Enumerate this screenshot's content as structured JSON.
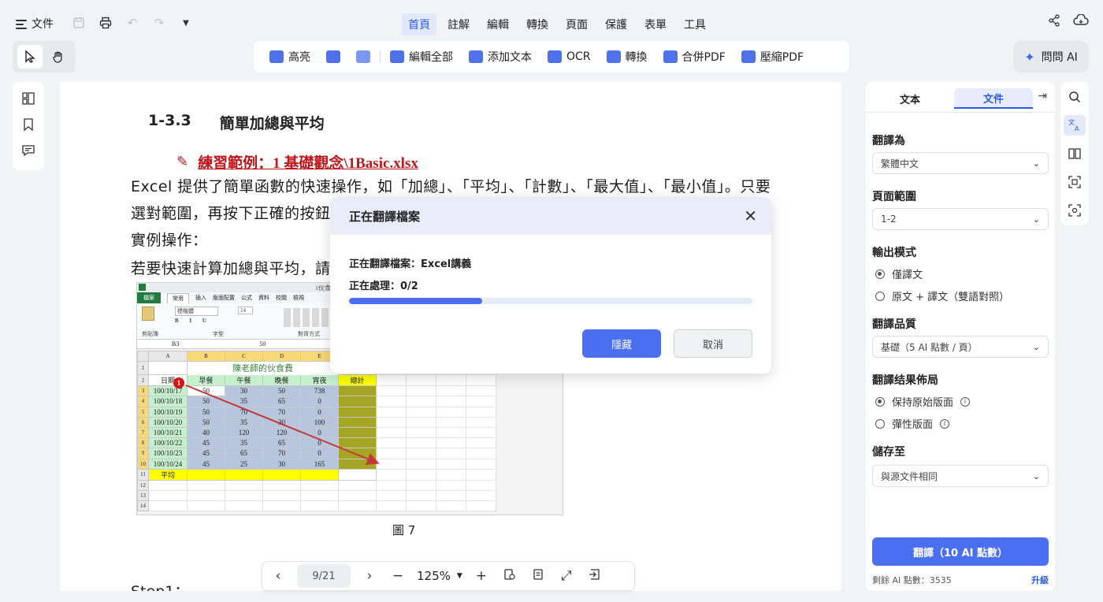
{
  "topbar": {
    "file_label": "文件",
    "menu_tabs": [
      "首頁",
      "註解",
      "編輯",
      "轉換",
      "頁面",
      "保護",
      "表單",
      "工具"
    ],
    "active_tab": "首頁"
  },
  "ribbon": {
    "items": [
      "高亮",
      "編輯全部",
      "添加文本",
      "OCR",
      "轉換",
      "合併PDF",
      "壓縮PDF"
    ]
  },
  "ask_ai": "問問 AI",
  "document": {
    "section_no": "1-3.3",
    "section_title": "簡單加總與平均",
    "practice_link": "練習範例：1 基礎觀念\\1Basic.xlsx",
    "line1": "Excel  提供了簡單函數的快速操作，如「加總」、「平均」、「計數」、「最大值」、「最小值」。只要",
    "line2": "選對範圍，再按下正確的按鈕",
    "line3": "實例操作：",
    "line4": "若要快速計算加總與平均，請",
    "figure_caption": "圖  7",
    "step": "Step1："
  },
  "excel": {
    "title_fragment": "1伙食費",
    "tab_file": "檔案",
    "tab_home": "常用",
    "tabs_rest": [
      "插入",
      "版面配置",
      "公式",
      "資料",
      "校閱",
      "檢視"
    ],
    "font_name": "標楷體",
    "font_size": "14",
    "cell_ref": "B3",
    "formula_value": "50",
    "ribbon_groups": [
      "剪貼簿",
      "字型",
      "對齊方式"
    ],
    "col_headers": [
      "A",
      "B",
      "C",
      "D",
      "E",
      "F"
    ],
    "sheet_title": "陳老師的伙食費",
    "header_row": [
      "日期",
      "早餐",
      "午餐",
      "晚餐",
      "宵夜",
      "總計"
    ],
    "rows": [
      [
        "100/10/17",
        "50",
        "30",
        "50",
        "738"
      ],
      [
        "100/10/18",
        "50",
        "35",
        "65",
        "0"
      ],
      [
        "100/10/19",
        "50",
        "70",
        "70",
        "0"
      ],
      [
        "100/10/20",
        "50",
        "35",
        "30",
        "100"
      ],
      [
        "100/10/21",
        "40",
        "120",
        "120",
        "0"
      ],
      [
        "100/10/22",
        "45",
        "35",
        "65",
        "0"
      ],
      [
        "100/10/23",
        "45",
        "65",
        "70",
        "0"
      ],
      [
        "100/10/24",
        "45",
        "25",
        "30",
        "165"
      ]
    ],
    "avg_label": "平均",
    "row_numbers": [
      "1",
      "2",
      "3",
      "4",
      "5",
      "6",
      "7",
      "8",
      "9",
      "10",
      "11",
      "12",
      "13",
      "14"
    ],
    "marker": "1"
  },
  "navbar": {
    "page": "9/21",
    "zoom": "125%"
  },
  "right_panel": {
    "tab_text": "文本",
    "tab_file": "文件",
    "translate_to_label": "翻譯為",
    "translate_to_value": "繁體中文",
    "page_range_label": "頁面範圍",
    "page_range_value": "1-2",
    "output_mode_label": "輸出模式",
    "output_opt1": "僅譯文",
    "output_opt2": "原文 + 譯文（雙語對照）",
    "quality_label": "翻譯品質",
    "quality_value": "基礎（5 AI 點數 / 頁）",
    "layout_label": "翻譯结果佈局",
    "layout_opt1": "保持原始版面",
    "layout_opt2": "彈性版面",
    "save_label": "儲存至",
    "save_value": "與源文件相同",
    "translate_button": "翻譯（10 AI 點數）",
    "remaining": "剩餘 AI 點數：3535",
    "upgrade": "升級"
  },
  "modal": {
    "title": "正在翻譯檔案",
    "line1": "正在翻譯檔案：Excel講義",
    "line2": "正在處理：0/2",
    "progress_fraction": 0.33,
    "hide_button": "隱藏",
    "cancel_button": "取消"
  },
  "colors": {
    "accent": "#4a6ff0",
    "link_red": "#c0151b"
  }
}
